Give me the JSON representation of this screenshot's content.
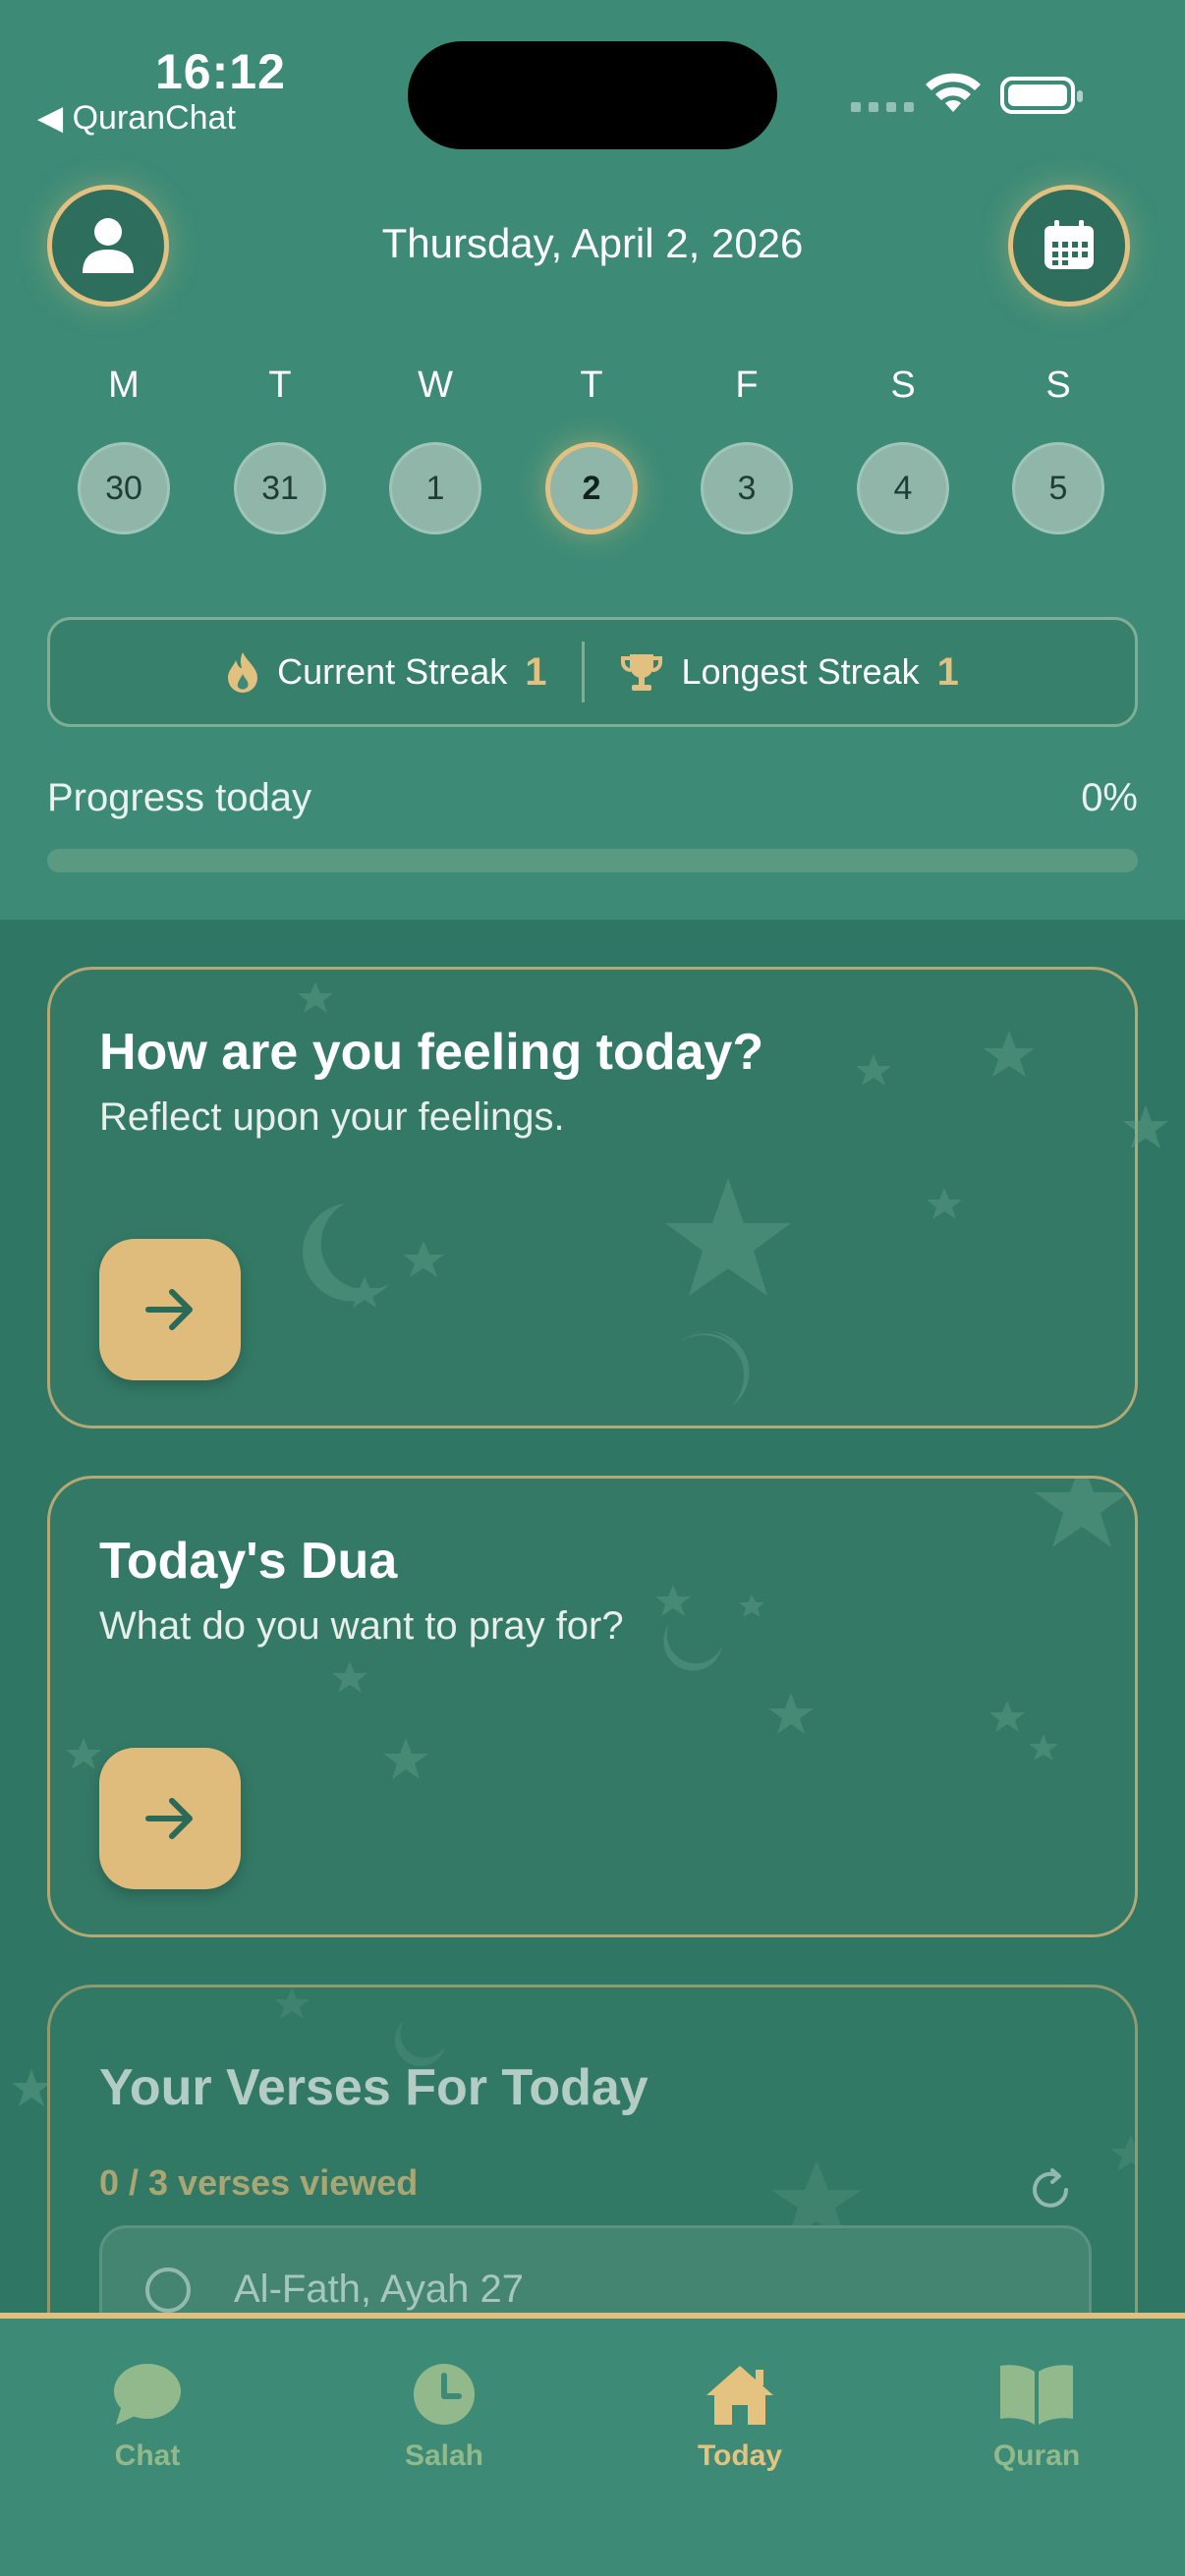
{
  "status_bar": {
    "time": "16:12",
    "back_label": "◀ QuranChat"
  },
  "header": {
    "date_title": "Thursday, April 2, 2026",
    "profile_icon": "person-icon",
    "calendar_icon": "calendar-icon"
  },
  "week": {
    "days": [
      {
        "letter": "M",
        "num": "30"
      },
      {
        "letter": "T",
        "num": "31"
      },
      {
        "letter": "W",
        "num": "1"
      },
      {
        "letter": "T",
        "num": "2",
        "selected": true
      },
      {
        "letter": "F",
        "num": "3"
      },
      {
        "letter": "S",
        "num": "4"
      },
      {
        "letter": "S",
        "num": "5"
      }
    ]
  },
  "streaks": {
    "current_label": "Current Streak",
    "current_value": "1",
    "longest_label": "Longest Streak",
    "longest_value": "1"
  },
  "progress": {
    "label": "Progress today",
    "value_text": "0%",
    "fraction": 0
  },
  "feeling_card": {
    "title": "How are you feeling today?",
    "subtitle": "Reflect upon your feelings."
  },
  "dua_card": {
    "title": "Today's Dua",
    "subtitle": "What do you want to pray for?"
  },
  "verses_card": {
    "title": "Your Verses For Today",
    "count_text": "0 / 3 verses viewed",
    "items": [
      {
        "label": "Al-Fath, Ayah 27"
      }
    ]
  },
  "tabs": [
    {
      "label": "Chat",
      "icon": "chat-bubble-icon",
      "active": false
    },
    {
      "label": "Salah",
      "icon": "clock-icon",
      "active": false
    },
    {
      "label": "Today",
      "icon": "home-icon",
      "active": true
    },
    {
      "label": "Quran",
      "icon": "book-icon",
      "active": false
    }
  ],
  "colors": {
    "accent": "#e2c080",
    "header_bg": "#3d8b76",
    "body_bg": "#2f7664"
  }
}
